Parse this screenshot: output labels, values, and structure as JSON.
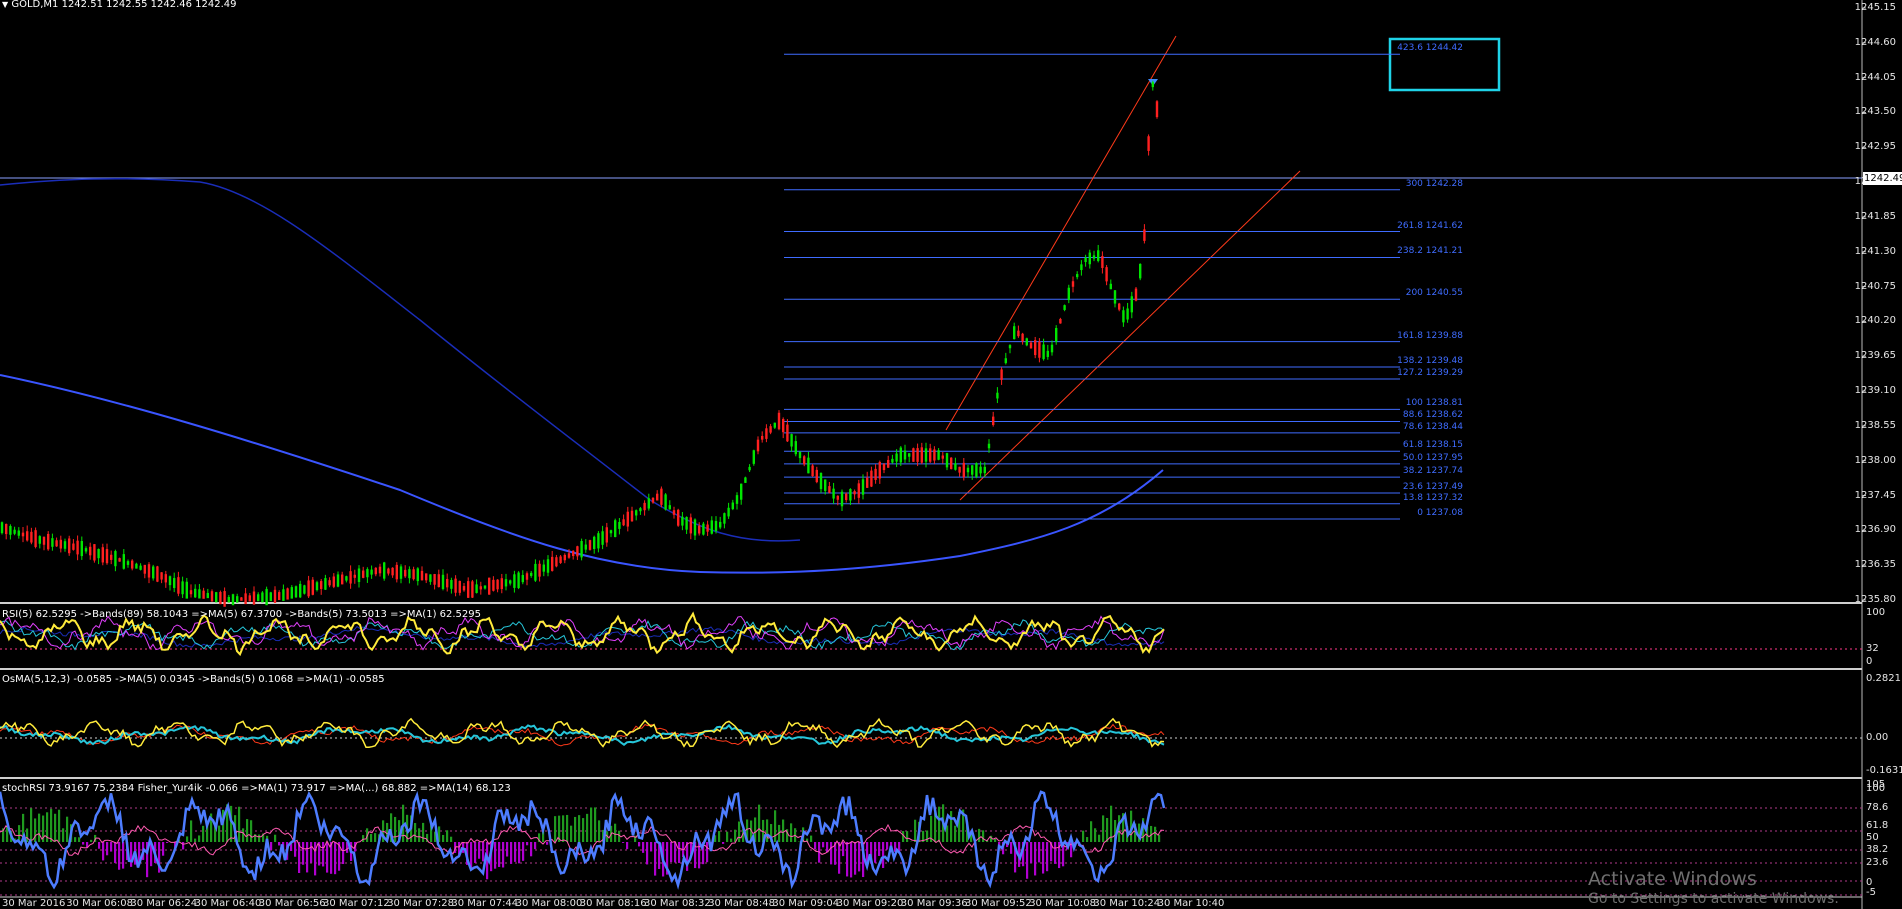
{
  "header": {
    "title": "GOLD,M1  1242.51 1242.55 1242.46 1242.49"
  },
  "current_price": "1242.49",
  "price_axis": [
    "1245.15",
    "1244.60",
    "1244.05",
    "1243.50",
    "1242.95",
    "1242.40",
    "1241.85",
    "1241.30",
    "1240.75",
    "1240.20",
    "1239.65",
    "1239.10",
    "1238.55",
    "1238.00",
    "1237.45",
    "1236.90",
    "1236.35",
    "1235.80"
  ],
  "fib_levels": [
    {
      "label": "423.6 1244.42",
      "value": 1244.42
    },
    {
      "label": "300 1242.28",
      "value": 1242.28
    },
    {
      "label": "261.8 1241.62",
      "value": 1241.62
    },
    {
      "label": "238.2 1241.21",
      "value": 1241.21
    },
    {
      "label": "200 1240.55",
      "value": 1240.55
    },
    {
      "label": "161.8 1239.88",
      "value": 1239.88
    },
    {
      "label": "138.2 1239.48",
      "value": 1239.48
    },
    {
      "label": "127.2 1239.29",
      "value": 1239.29
    },
    {
      "label": "100 1238.81",
      "value": 1238.81
    },
    {
      "label": "88.6 1238.62",
      "value": 1238.62
    },
    {
      "label": "78.6 1238.44",
      "value": 1238.44
    },
    {
      "label": "61.8 1238.15",
      "value": 1238.15
    },
    {
      "label": "50.0 1237.95",
      "value": 1237.95
    },
    {
      "label": "38.2 1237.74",
      "value": 1237.74
    },
    {
      "label": "23.6 1237.49",
      "value": 1237.49
    },
    {
      "label": "13.8 1237.32",
      "value": 1237.32
    },
    {
      "label": "0 1237.08",
      "value": 1237.08
    }
  ],
  "indicators": {
    "rsi": {
      "label": "RSI(5) 62.5295  ->Bands(89) 58.1043  =>MA(5) 67.3700  ->Bands(5) 73.5013  =>MA(1) 62.5295",
      "axis": [
        "100",
        "32",
        "0"
      ]
    },
    "osma": {
      "label": "OsMA(5,12,3) -0.0585  ->MA(5) 0.0345  ->Bands(5) 0.1068  =>MA(1) -0.0585",
      "axis": [
        "0.2821",
        "0.00",
        "-0.1631"
      ]
    },
    "stoch": {
      "label": "stochRSI 73.9167 75.2384  Fisher_Yur4ik -0.066  =>MA(1) 73.917  =>MA(...) 68.882  =>MA(14) 68.123",
      "axis": [
        "105",
        "100",
        "78.6",
        "61.8",
        "50",
        "38.2",
        "23.6",
        "0",
        "-5"
      ]
    }
  },
  "time_axis": [
    "30 Mar 2016",
    "30 Mar 06:08",
    "30 Mar 06:24",
    "30 Mar 06:40",
    "30 Mar 06:56",
    "30 Mar 07:12",
    "30 Mar 07:28",
    "30 Mar 07:44",
    "30 Mar 08:00",
    "30 Mar 08:16",
    "30 Mar 08:32",
    "30 Mar 08:48",
    "30 Mar 09:04",
    "30 Mar 09:20",
    "30 Mar 09:36",
    "30 Mar 09:52",
    "30 Mar 10:08",
    "30 Mar 10:24",
    "30 Mar 10:40"
  ],
  "watermark": {
    "line1": "Activate Windows",
    "line2": "Go to Settings to activate Windows."
  },
  "colors": {
    "bull": "#00e600",
    "bear": "#ff2020",
    "fib": "#3f6cff",
    "highlight": "#1fd3e8",
    "channel": "#ff3a1a"
  }
}
